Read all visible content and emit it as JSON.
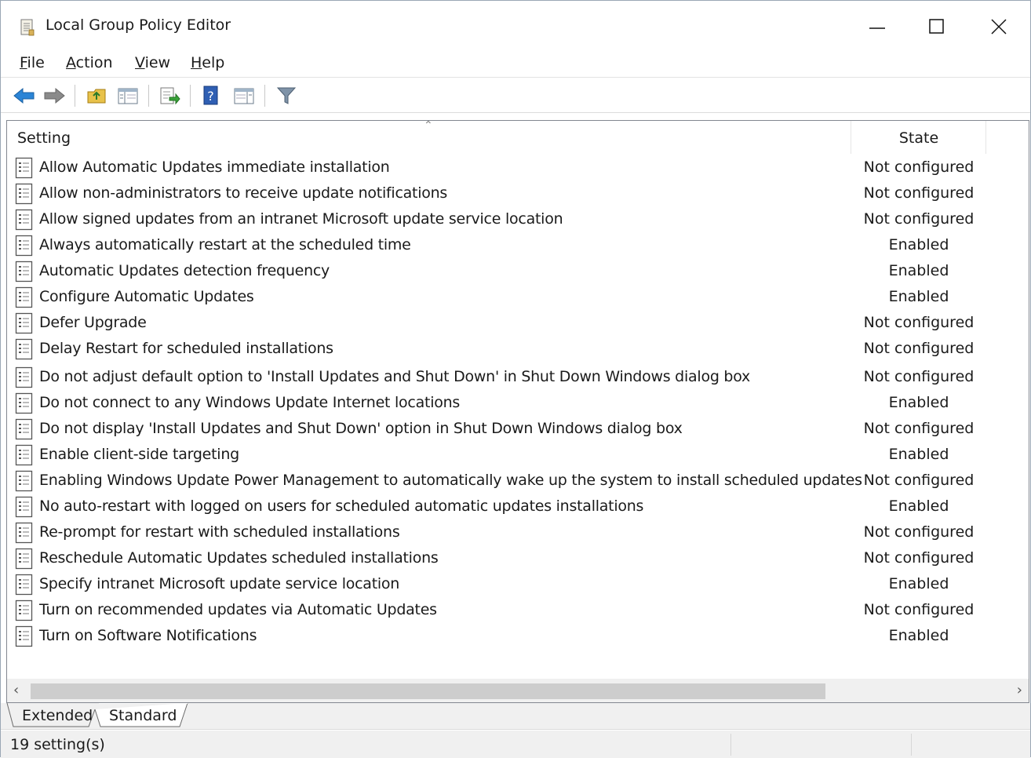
{
  "window": {
    "title": "Local Group Policy Editor"
  },
  "menu": {
    "file": {
      "underline": "F",
      "rest": "ile"
    },
    "action": {
      "underline": "A",
      "rest": "ction"
    },
    "view": {
      "underline": "V",
      "rest": "iew"
    },
    "help": {
      "underline": "H",
      "rest": "elp"
    }
  },
  "toolbar": {
    "icons": [
      "back-icon",
      "forward-icon",
      "up-folder-icon",
      "show-hide-console-tree-icon",
      "export-list-icon",
      "help-icon",
      "show-hide-action-pane-icon",
      "filter-icon"
    ]
  },
  "list": {
    "columns": {
      "setting": "Setting",
      "state": "State"
    },
    "rows": [
      {
        "name": "Allow Automatic Updates immediate installation",
        "state": "Not configured"
      },
      {
        "name": "Allow non-administrators to receive update notifications",
        "state": "Not configured"
      },
      {
        "name": "Allow signed updates from an intranet Microsoft update service location",
        "state": "Not configured"
      },
      {
        "name": "Always automatically restart at the scheduled time",
        "state": "Enabled"
      },
      {
        "name": "Automatic Updates detection frequency",
        "state": "Enabled"
      },
      {
        "name": "Configure Automatic Updates",
        "state": "Enabled"
      },
      {
        "name": "Defer Upgrade",
        "state": "Not configured"
      },
      {
        "name": "Delay Restart for scheduled installations",
        "state": "Not configured"
      },
      {
        "name": "Do not adjust default option to 'Install Updates and Shut Down' in Shut Down Windows dialog box",
        "state": "Not configured"
      },
      {
        "name": "Do not connect to any Windows Update Internet locations",
        "state": "Enabled"
      },
      {
        "name": "Do not display 'Install Updates and Shut Down' option in Shut Down Windows dialog box",
        "state": "Not configured"
      },
      {
        "name": "Enable client-side targeting",
        "state": "Enabled"
      },
      {
        "name": "Enabling Windows Update Power Management to automatically wake up the system to install scheduled updates",
        "state": "Not configured"
      },
      {
        "name": "No auto-restart with logged on users for scheduled automatic updates installations",
        "state": "Enabled"
      },
      {
        "name": "Re-prompt for restart with scheduled installations",
        "state": "Not configured"
      },
      {
        "name": "Reschedule Automatic Updates scheduled installations",
        "state": "Not configured"
      },
      {
        "name": "Specify intranet Microsoft update service location",
        "state": "Enabled"
      },
      {
        "name": "Turn on recommended updates via Automatic Updates",
        "state": "Not configured"
      },
      {
        "name": "Turn on Software Notifications",
        "state": "Enabled"
      }
    ]
  },
  "tabs": [
    {
      "label": "Extended",
      "active": false
    },
    {
      "label": "Standard",
      "active": true
    }
  ],
  "status": {
    "text": "19 setting(s)"
  }
}
